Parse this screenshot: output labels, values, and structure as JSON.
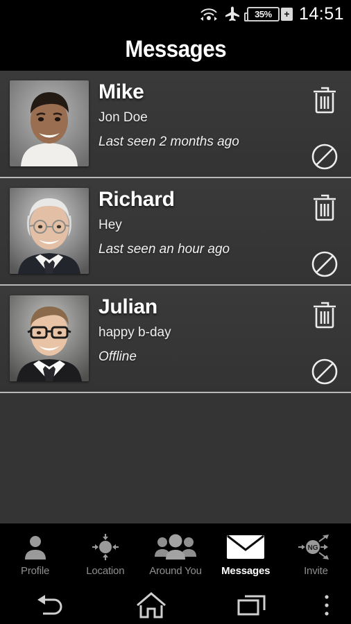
{
  "statusbar": {
    "wifi_icon": "wifi-icon",
    "airplane_icon": "airplane-mode-icon",
    "battery_icon": "battery-icon",
    "battery_percent": "35%",
    "battery_charging_icon": "battery-charging-plus-icon",
    "time": "14:51"
  },
  "header": {
    "title": "Messages"
  },
  "conversations": [
    {
      "name": "Mike",
      "message": "Jon Doe",
      "status": "Last seen 2 months ago",
      "avatar_alt": "smiling-man-dark-hair",
      "delete_icon": "trash-icon",
      "block_icon": "block-icon"
    },
    {
      "name": "Richard",
      "message": "Hey",
      "status": "Last seen an hour ago",
      "avatar_alt": "elderly-man-glasses-suit",
      "delete_icon": "trash-icon",
      "block_icon": "block-icon"
    },
    {
      "name": "Julian",
      "message": "happy b-day",
      "status": "Offline",
      "avatar_alt": "young-man-glasses-suit",
      "delete_icon": "trash-icon",
      "block_icon": "block-icon"
    }
  ],
  "tabs": [
    {
      "label": "Profile",
      "icon": "person-icon",
      "active": false
    },
    {
      "label": "Location",
      "icon": "location-target-icon",
      "active": false
    },
    {
      "label": "Around You",
      "icon": "people-group-icon",
      "active": false
    },
    {
      "label": "Messages",
      "icon": "envelope-icon",
      "active": true
    },
    {
      "label": "Invite",
      "icon": "invite-share-ng-icon",
      "active": false
    }
  ],
  "invite_badge_text": "NG",
  "sysnav": {
    "back": "back-icon",
    "home": "home-icon",
    "recents": "recent-apps-icon",
    "overflow": "overflow-menu-icon"
  },
  "colors": {
    "background": "#000000",
    "list_bg": "#343434",
    "divider": "#b9b9b9",
    "text_primary": "#ffffff",
    "text_muted": "#8f8f8f",
    "icon_gray": "#9a9a9a"
  }
}
